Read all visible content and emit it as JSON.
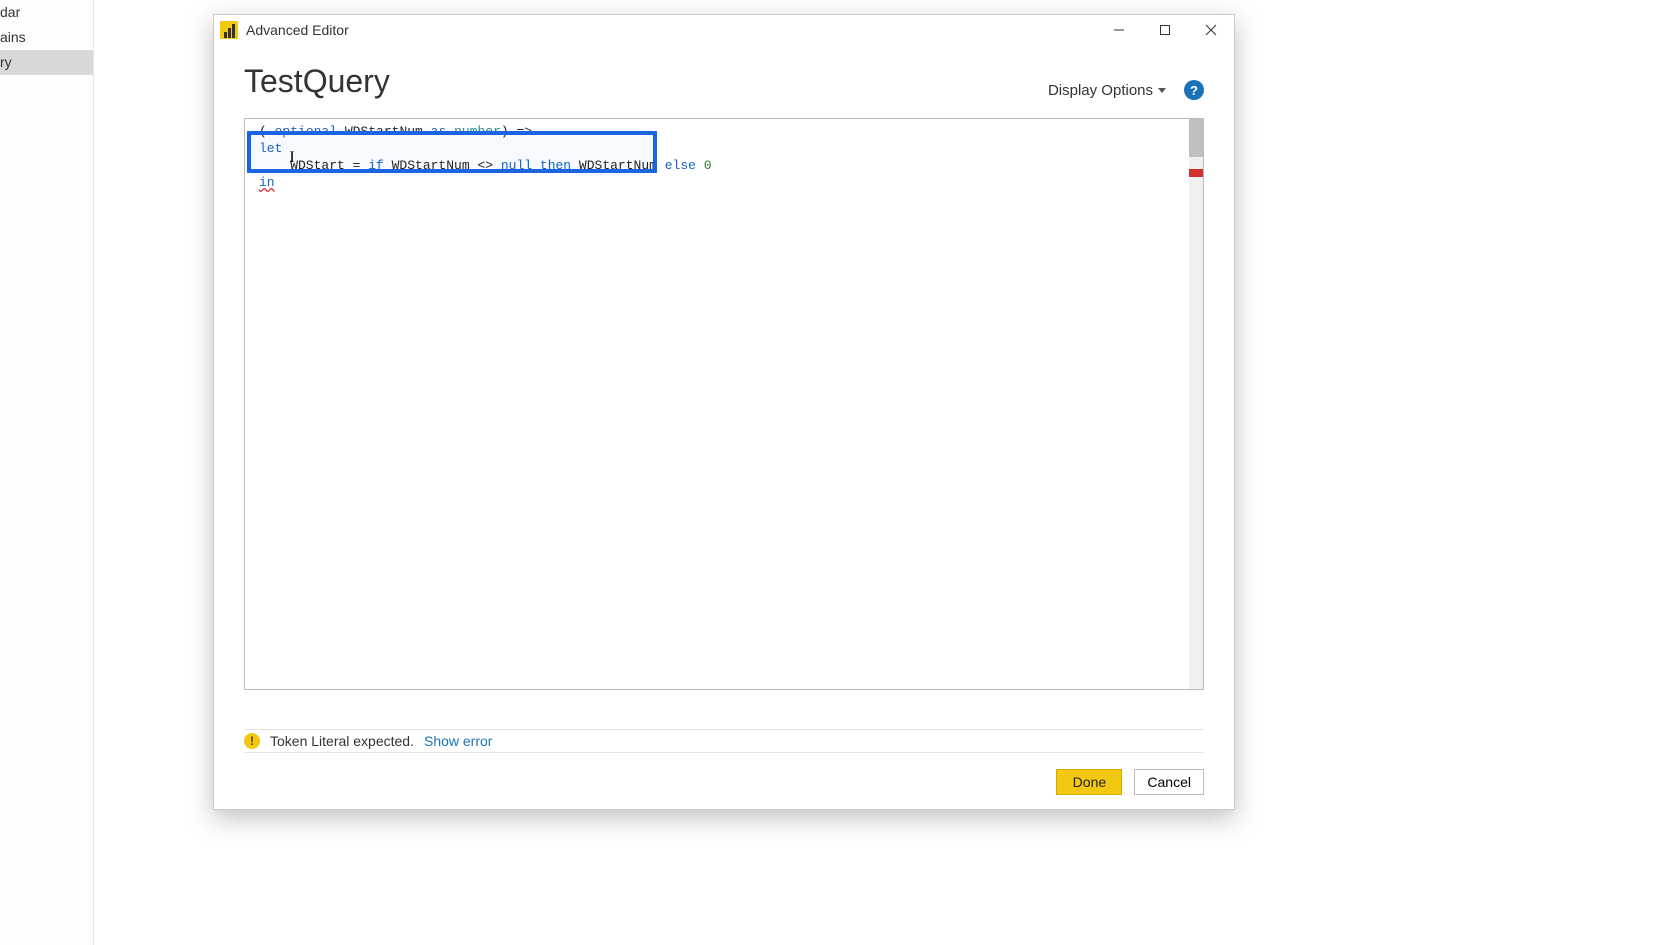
{
  "background_panel": {
    "items": [
      "dar",
      "ains",
      "ry"
    ],
    "selected_index": 2
  },
  "window": {
    "title": "Advanced Editor",
    "query_name": "TestQuery",
    "display_options_label": "Display Options",
    "help_glyph": "?"
  },
  "code": {
    "line1_pre": "( ",
    "line1_kw1": "optional",
    "line1_mid1": " WDStartNum ",
    "line1_kw2": "as",
    "line1_mid2": " ",
    "line1_type": "number",
    "line1_post": ") =>",
    "line2": "let",
    "line3_pre": "    WDStart = ",
    "line3_if": "if",
    "line3_m1": " WDStartNum <> ",
    "line3_null": "null",
    "line3_sp1": " ",
    "line3_then": "then",
    "line3_m2": " WDStartNum ",
    "line3_else": "else",
    "line3_sp2": " ",
    "line3_val": "0",
    "line4": "in"
  },
  "status": {
    "warn_glyph": "!",
    "message": "Token Literal expected.",
    "show_error": "Show error"
  },
  "buttons": {
    "done": "Done",
    "cancel": "Cancel"
  }
}
